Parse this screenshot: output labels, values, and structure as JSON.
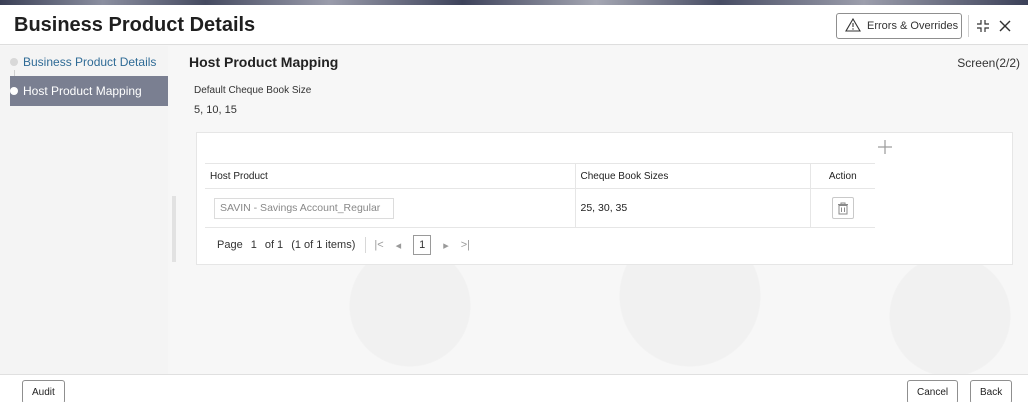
{
  "header": {
    "title": "Business Product Details",
    "errors_label": "Errors & Overrides"
  },
  "sidebar": {
    "items": [
      {
        "label": "Business Product Details",
        "active": false
      },
      {
        "label": "Host Product Mapping",
        "active": true
      }
    ]
  },
  "main": {
    "section_title": "Host Product Mapping",
    "screen_indicator": "Screen(2/2)",
    "default_cheque": {
      "label": "Default Cheque Book Size",
      "value": "5, 10, 15"
    },
    "table": {
      "columns": [
        "Host Product",
        "Cheque Book Sizes",
        "Action"
      ],
      "rows": [
        {
          "host_product": "SAVIN - Savings Account_Regular",
          "cheque_book_sizes": "25, 30, 35"
        }
      ]
    },
    "pagination": {
      "page_label": "Page",
      "current": "1",
      "of_label": "of 1",
      "items_label": "(1 of 1 items)",
      "page_box": "1"
    }
  },
  "footer": {
    "audit_label": "Audit",
    "cancel_label": "Cancel",
    "back_label": "Back"
  },
  "colors": {
    "active_nav_bg": "#7a7f91",
    "link": "#2f6b96"
  }
}
